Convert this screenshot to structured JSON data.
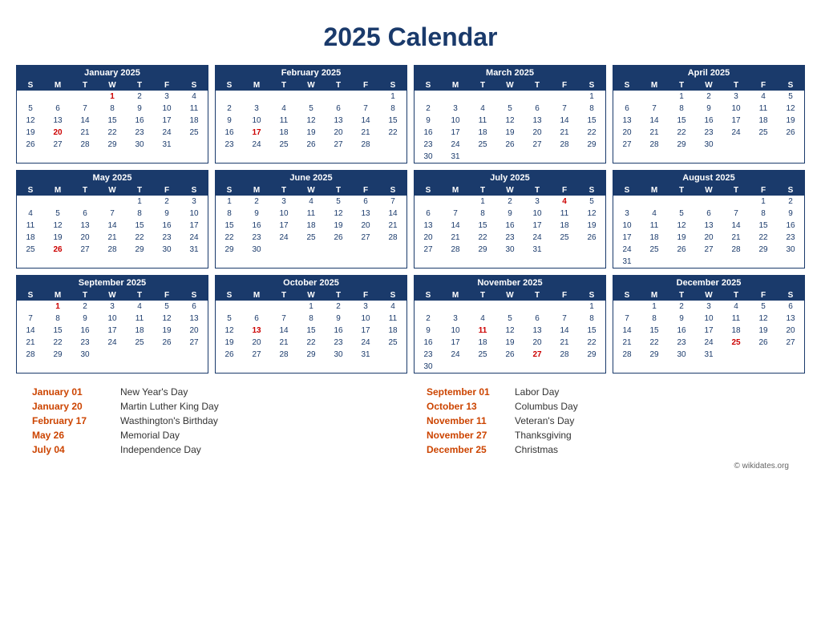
{
  "title": "2025 Calendar",
  "copyright": "© wikidates.org",
  "months": [
    {
      "name": "January 2025",
      "weeks": [
        [
          "",
          "",
          "",
          "1",
          "2",
          "3",
          "4"
        ],
        [
          "5",
          "6",
          "7",
          "8",
          "9",
          "10",
          "11"
        ],
        [
          "12",
          "13",
          "14",
          "15",
          "16",
          "17",
          "18"
        ],
        [
          "19",
          "20",
          "21",
          "22",
          "23",
          "24",
          "25"
        ],
        [
          "26",
          "27",
          "28",
          "29",
          "30",
          "31",
          ""
        ]
      ],
      "reds": {
        "1-3": "1",
        "2-1": "20"
      }
    },
    {
      "name": "February 2025",
      "weeks": [
        [
          "",
          "",
          "",
          "",
          "",
          "",
          "1"
        ],
        [
          "2",
          "3",
          "4",
          "5",
          "6",
          "7",
          "8"
        ],
        [
          "9",
          "10",
          "11",
          "12",
          "13",
          "14",
          "15"
        ],
        [
          "16",
          "17",
          "18",
          "19",
          "20",
          "21",
          "22"
        ],
        [
          "23",
          "24",
          "25",
          "26",
          "27",
          "28",
          ""
        ]
      ],
      "reds": {
        "3-1": "17"
      }
    },
    {
      "name": "March 2025",
      "weeks": [
        [
          "",
          "",
          "",
          "",
          "",
          "",
          "1"
        ],
        [
          "2",
          "3",
          "4",
          "5",
          "6",
          "7",
          "8"
        ],
        [
          "9",
          "10",
          "11",
          "12",
          "13",
          "14",
          "15"
        ],
        [
          "16",
          "17",
          "18",
          "19",
          "20",
          "21",
          "22"
        ],
        [
          "23",
          "24",
          "25",
          "26",
          "27",
          "28",
          "29"
        ],
        [
          "30",
          "31",
          "",
          "",
          "",
          "",
          ""
        ]
      ],
      "reds": {}
    },
    {
      "name": "April 2025",
      "weeks": [
        [
          "",
          "",
          "1",
          "2",
          "3",
          "4",
          "5"
        ],
        [
          "6",
          "7",
          "8",
          "9",
          "10",
          "11",
          "12"
        ],
        [
          "13",
          "14",
          "15",
          "16",
          "17",
          "18",
          "19"
        ],
        [
          "20",
          "21",
          "22",
          "23",
          "24",
          "25",
          "26"
        ],
        [
          "27",
          "28",
          "29",
          "30",
          "",
          "",
          ""
        ]
      ],
      "reds": {}
    },
    {
      "name": "May 2025",
      "weeks": [
        [
          "",
          "",
          "",
          "",
          "1",
          "2",
          "3"
        ],
        [
          "4",
          "5",
          "6",
          "7",
          "8",
          "9",
          "10"
        ],
        [
          "11",
          "12",
          "13",
          "14",
          "15",
          "16",
          "17"
        ],
        [
          "18",
          "19",
          "20",
          "21",
          "22",
          "23",
          "24"
        ],
        [
          "25",
          "26",
          "27",
          "28",
          "29",
          "30",
          "31"
        ]
      ],
      "reds": {
        "4-1": "26"
      }
    },
    {
      "name": "June 2025",
      "weeks": [
        [
          "1",
          "2",
          "3",
          "4",
          "5",
          "6",
          "7"
        ],
        [
          "8",
          "9",
          "10",
          "11",
          "12",
          "13",
          "14"
        ],
        [
          "15",
          "16",
          "17",
          "18",
          "19",
          "20",
          "21"
        ],
        [
          "22",
          "23",
          "24",
          "25",
          "26",
          "27",
          "28"
        ],
        [
          "29",
          "30",
          "",
          "",
          "",
          "",
          ""
        ]
      ],
      "reds": {}
    },
    {
      "name": "July 2025",
      "weeks": [
        [
          "",
          "",
          "1",
          "2",
          "3",
          "4",
          "5"
        ],
        [
          "6",
          "7",
          "8",
          "9",
          "10",
          "11",
          "12"
        ],
        [
          "13",
          "14",
          "15",
          "16",
          "17",
          "18",
          "19"
        ],
        [
          "20",
          "21",
          "22",
          "23",
          "24",
          "25",
          "26"
        ],
        [
          "27",
          "28",
          "29",
          "30",
          "31",
          "",
          ""
        ]
      ],
      "reds": {
        "1-5": "4"
      }
    },
    {
      "name": "August 2025",
      "weeks": [
        [
          "",
          "",
          "",
          "",
          "",
          "1",
          "2"
        ],
        [
          "3",
          "4",
          "5",
          "6",
          "7",
          "8",
          "9"
        ],
        [
          "10",
          "11",
          "12",
          "13",
          "14",
          "15",
          "16"
        ],
        [
          "17",
          "18",
          "19",
          "20",
          "21",
          "22",
          "23"
        ],
        [
          "24",
          "25",
          "26",
          "27",
          "28",
          "29",
          "30"
        ],
        [
          "31",
          "",
          "",
          "",
          "",
          "",
          ""
        ]
      ],
      "reds": {}
    },
    {
      "name": "September 2025",
      "weeks": [
        [
          "",
          "1",
          "2",
          "3",
          "4",
          "5",
          "6"
        ],
        [
          "7",
          "8",
          "9",
          "10",
          "11",
          "12",
          "13"
        ],
        [
          "14",
          "15",
          "16",
          "17",
          "18",
          "19",
          "20"
        ],
        [
          "21",
          "22",
          "23",
          "24",
          "25",
          "26",
          "27"
        ],
        [
          "28",
          "29",
          "30",
          "",
          "",
          "",
          ""
        ]
      ],
      "reds": {
        "1-1": "1"
      }
    },
    {
      "name": "October 2025",
      "weeks": [
        [
          "",
          "",
          "",
          "1",
          "2",
          "3",
          "4"
        ],
        [
          "5",
          "6",
          "7",
          "8",
          "9",
          "10",
          "11"
        ],
        [
          "12",
          "13",
          "14",
          "15",
          "16",
          "17",
          "18"
        ],
        [
          "19",
          "20",
          "21",
          "22",
          "23",
          "24",
          "25"
        ],
        [
          "26",
          "27",
          "28",
          "29",
          "30",
          "31",
          ""
        ]
      ],
      "reds": {
        "3-1": "13"
      }
    },
    {
      "name": "November 2025",
      "weeks": [
        [
          "",
          "",
          "",
          "",
          "",
          "",
          "1"
        ],
        [
          "2",
          "3",
          "4",
          "5",
          "6",
          "7",
          "8"
        ],
        [
          "9",
          "10",
          "11",
          "12",
          "13",
          "14",
          "15"
        ],
        [
          "16",
          "17",
          "18",
          "19",
          "20",
          "21",
          "22"
        ],
        [
          "23",
          "24",
          "25",
          "26",
          "27",
          "28",
          "29"
        ],
        [
          "30",
          "",
          "",
          "",
          "",
          "",
          ""
        ]
      ],
      "reds": {
        "3-1": "11",
        "4-1": "27"
      }
    },
    {
      "name": "December 2025",
      "weeks": [
        [
          "",
          "1",
          "2",
          "3",
          "4",
          "5",
          "6"
        ],
        [
          "7",
          "8",
          "9",
          "10",
          "11",
          "12",
          "13"
        ],
        [
          "14",
          "15",
          "16",
          "17",
          "18",
          "19",
          "20"
        ],
        [
          "21",
          "22",
          "23",
          "24",
          "25",
          "26",
          "27"
        ],
        [
          "28",
          "29",
          "30",
          "31",
          "",
          "",
          ""
        ]
      ],
      "reds": {
        "4-5": "25"
      }
    }
  ],
  "days_header": [
    "S",
    "M",
    "T",
    "W",
    "T",
    "F",
    "S"
  ],
  "holidays": [
    {
      "date": "January 01",
      "name": "New Year's Day"
    },
    {
      "date": "January 20",
      "name": "Martin Luther King Day"
    },
    {
      "date": "February 17",
      "name": "Wasthington's Birthday"
    },
    {
      "date": "May 26",
      "name": "Memorial Day"
    },
    {
      "date": "July 04",
      "name": "Independence Day"
    },
    {
      "date": "September 01",
      "name": "Labor Day"
    },
    {
      "date": "October 13",
      "name": "Columbus Day"
    },
    {
      "date": "November 11",
      "name": "Veteran's Day"
    },
    {
      "date": "November 27",
      "name": "Thanksgiving"
    },
    {
      "date": "December 25",
      "name": "Christmas"
    }
  ]
}
